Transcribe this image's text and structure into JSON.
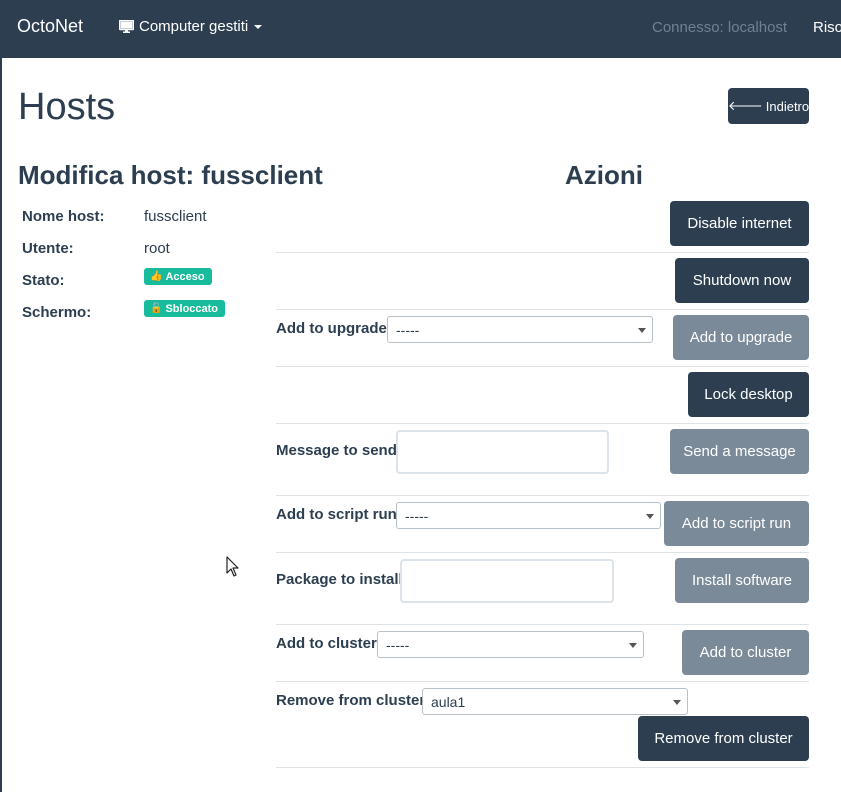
{
  "navbar": {
    "brand": "OctoNet",
    "menu_label": "Computer gestiti",
    "status": "Connesso: localhost",
    "right_link": "Riso"
  },
  "page": {
    "title": "Hosts",
    "back_label": "Indietro"
  },
  "host": {
    "heading": "Modifica host: fussclient",
    "fields": [
      {
        "label": "Nome host:",
        "value": "fussclient"
      },
      {
        "label": "Utente:",
        "value": "root"
      },
      {
        "label": "Stato:",
        "value": "Acceso"
      },
      {
        "label": "Schermo:",
        "value": "Sbloccato"
      }
    ],
    "status_color": "#18bc9c"
  },
  "actions": {
    "heading": "Azioni",
    "disable_internet": "Disable internet",
    "shutdown": "Shutdown now",
    "upgrade": {
      "label": "Add to upgrade:",
      "selected": "-----",
      "button": "Add to upgrade"
    },
    "lock": "Lock desktop",
    "message": {
      "label": "Message to send:",
      "value": "",
      "button": "Send a message"
    },
    "script": {
      "label": "Add to script run:",
      "selected": "-----",
      "button": "Add to script run"
    },
    "package": {
      "label": "Package to install:",
      "value": "",
      "button": "Install software"
    },
    "cluster_add": {
      "label": "Add to cluster:",
      "selected": "-----",
      "button": "Add to cluster"
    },
    "cluster_remove": {
      "label": "Remove from cluster:",
      "selected": "aula1",
      "button": "Remove from cluster"
    }
  },
  "colors": {
    "primary": "#2c3e50",
    "secondary": "#7b8a98",
    "success": "#18bc9c"
  }
}
